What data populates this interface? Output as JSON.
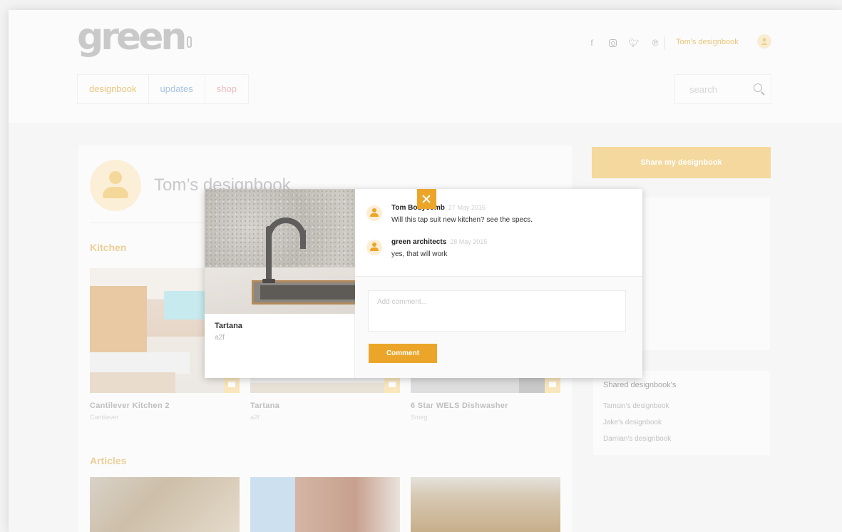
{
  "brand": {
    "logo_text": "green"
  },
  "header": {
    "social": [
      "f",
      "instagram",
      "twitter",
      "pinterest"
    ],
    "user_link": "Tom's designbook"
  },
  "nav": {
    "items": [
      {
        "label": "designbook"
      },
      {
        "label": "updates"
      },
      {
        "label": "shop"
      }
    ]
  },
  "search": {
    "placeholder": "search"
  },
  "profile": {
    "name": "Tom’s designbook"
  },
  "sections": {
    "kitchen": "Kitchen",
    "articles": "Articles"
  },
  "kitchen_cards": [
    {
      "name": "Cantilever Kitchen 2",
      "sub": "Cantilever"
    },
    {
      "name": "Tartana",
      "sub": "a2f"
    },
    {
      "name": "6 Star WELS Dishwasher",
      "sub": "Smeg"
    }
  ],
  "sidebar": {
    "share_label": "Share my designbook",
    "shared_title": "Shared designbook's",
    "shared_links": [
      "Tamsin's designbook",
      "Jake's designbook",
      "Damian's designbook"
    ]
  },
  "modal": {
    "product_name": "Tartana",
    "product_sub": "a2f",
    "comments": [
      {
        "author": "Tom Bodycomb",
        "date": "27 May 2015",
        "text": "Will this tap suit new kitchen? see the specs."
      },
      {
        "author": "green architects",
        "date": "28 May 2015",
        "text": "yes, that will work"
      }
    ],
    "add_placeholder": "Add comment...",
    "comment_button": "Comment"
  },
  "colors": {
    "accent": "#eba629",
    "accent_faded": "#f4d89d",
    "nav_updates": "#a9c2e3",
    "nav_shop": "#f0b9bb"
  }
}
